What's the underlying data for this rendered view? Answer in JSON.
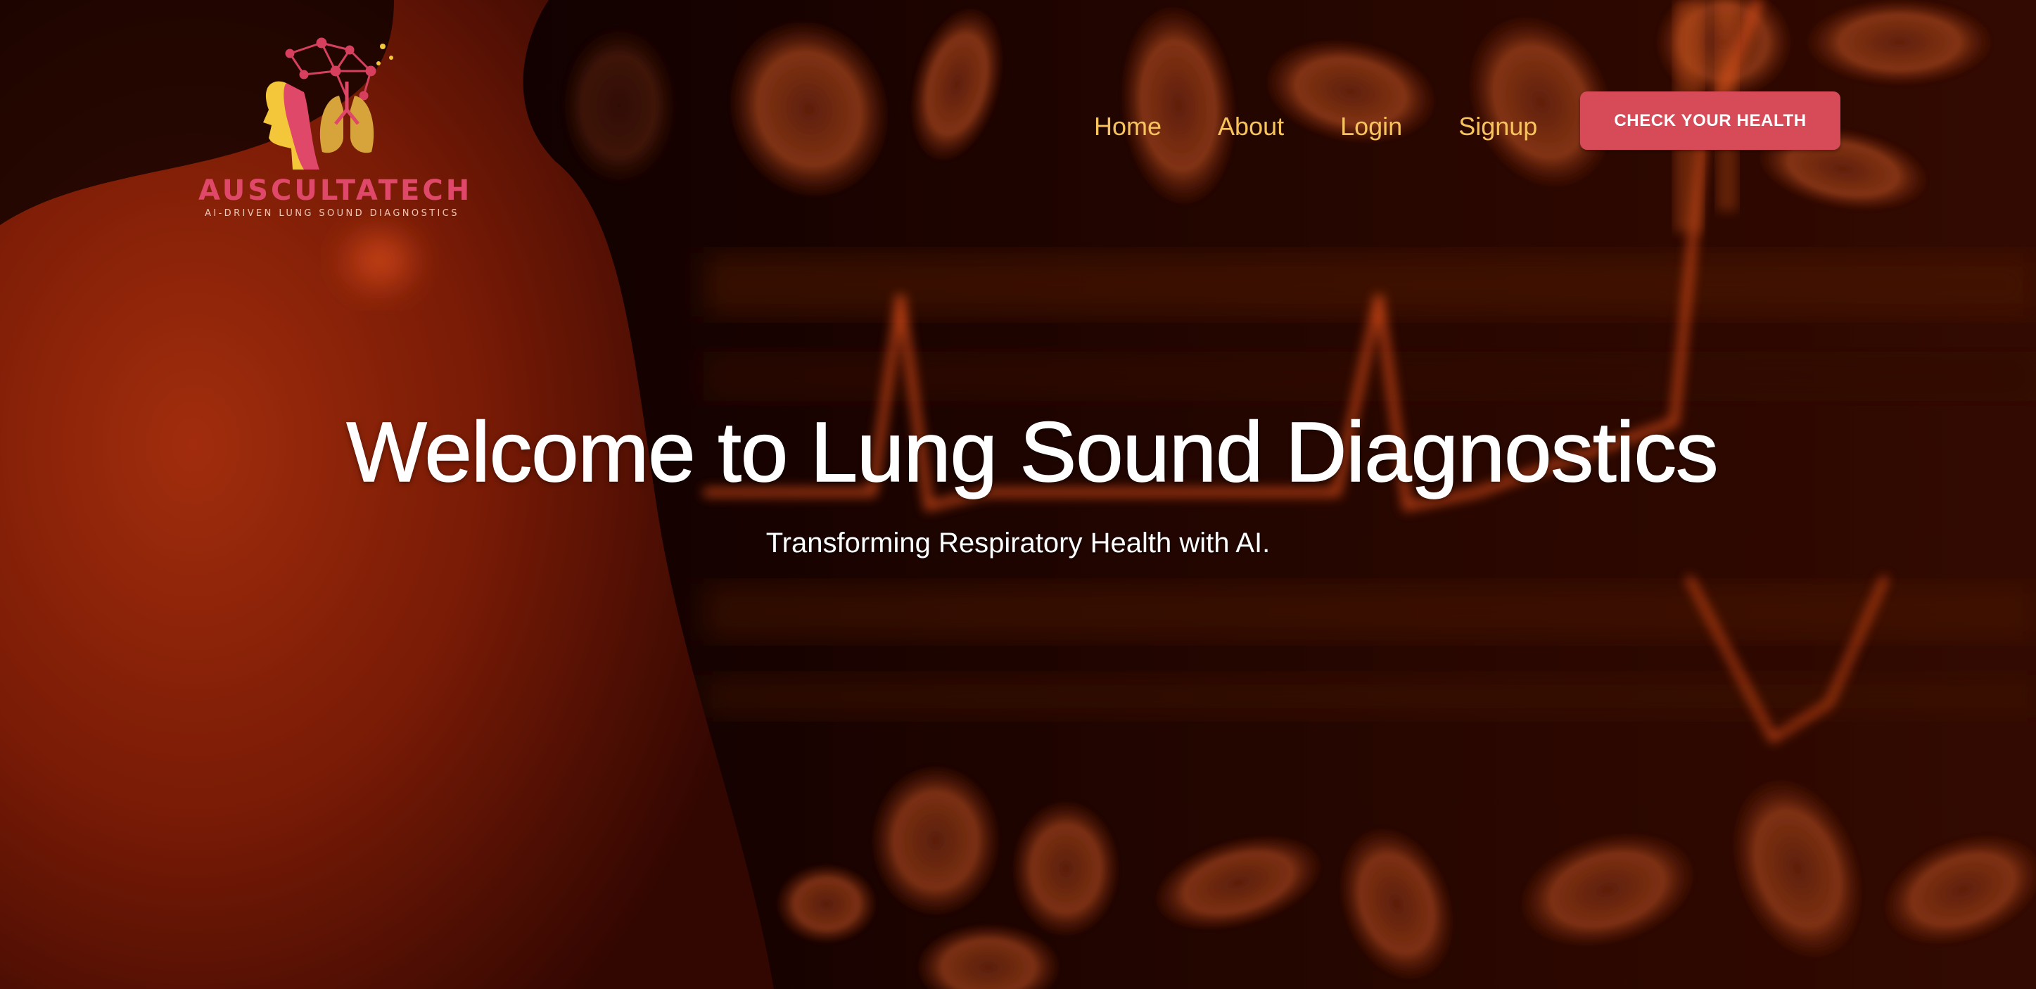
{
  "brand": {
    "name": "AUSCULTATECH",
    "tagline": "AI-DRIVEN LUNG SOUND DIAGNOSTICS",
    "colors": {
      "pink": "#e0486a",
      "gold": "#f6c35e",
      "yellow": "#f4d03f"
    }
  },
  "nav": {
    "items": [
      {
        "label": "Home"
      },
      {
        "label": "About"
      },
      {
        "label": "Login"
      },
      {
        "label": "Signup"
      }
    ],
    "link_color": "#f6c35e"
  },
  "cta": {
    "label": "CHECK YOUR HEALTH",
    "color": "#d64b57"
  },
  "hero": {
    "title": "Welcome to Lung Sound Diagnostics",
    "subtitle": "Transforming Respiratory Health with AI."
  },
  "background": {
    "description_colors": {
      "dark": "#0a0000",
      "red": "#8c1d06",
      "orange": "#c4461a"
    }
  }
}
